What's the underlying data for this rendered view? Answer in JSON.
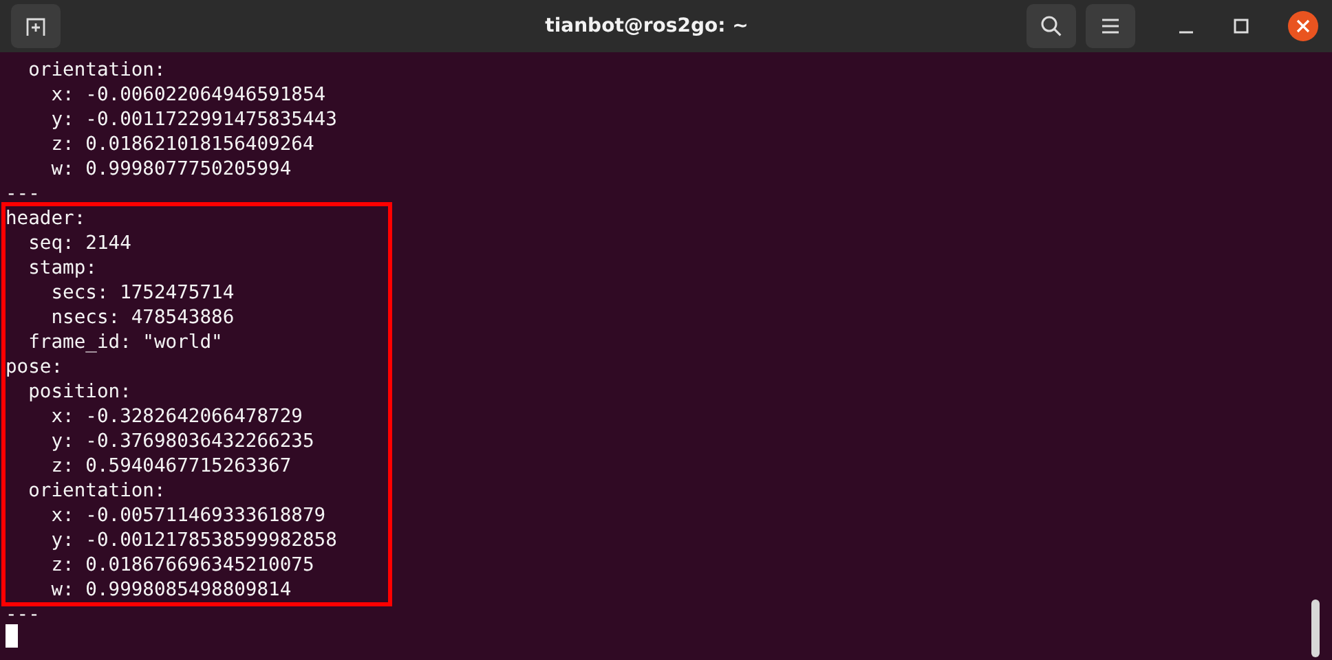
{
  "window": {
    "title": "tianbot@ros2go: ~"
  },
  "terminal": {
    "blocks": [
      {
        "highlighted": false,
        "lines": [
          "  orientation:",
          "    x: -0.006022064946591854",
          "    y: -0.0011722991475835443",
          "    z: 0.018621018156409264",
          "    w: 0.9998077750205994",
          "---"
        ]
      },
      {
        "highlighted": true,
        "lines": [
          "header:",
          "  seq: 2144",
          "  stamp:",
          "    secs: 1752475714",
          "    nsecs: 478543886",
          "  frame_id: \"world\"",
          "pose:",
          "  position:",
          "    x: -0.3282642066478729",
          "    y: -0.37698036432266235",
          "    z: 0.5940467715263367",
          "  orientation:",
          "    x: -0.005711469333618879",
          "    y: -0.0012178538599982858",
          "    z: 0.018676696345210075",
          "    w: 0.9998085498809814"
        ]
      },
      {
        "highlighted": false,
        "lines": [
          "---"
        ]
      }
    ],
    "cursor": true
  }
}
